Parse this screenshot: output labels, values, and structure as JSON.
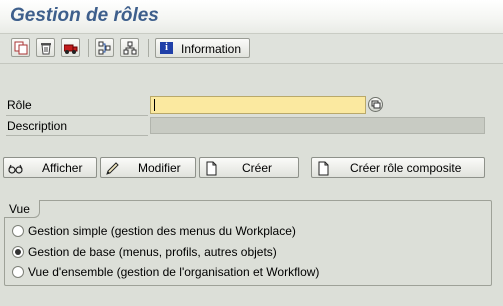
{
  "title": "Gestion de rôles",
  "toolbar": {
    "buttons": [
      {
        "name": "copy-icon"
      },
      {
        "name": "delete-icon"
      },
      {
        "name": "transport-icon"
      },
      {
        "name": "where-used-icon"
      },
      {
        "name": "hierarchy-icon"
      }
    ],
    "information_label": "Information",
    "information_icon": "info-icon"
  },
  "form": {
    "role_label": "Rôle",
    "role_value": "",
    "description_label": "Description",
    "description_value": ""
  },
  "actions": {
    "display_label": "Afficher",
    "change_label": "Modifier",
    "create_label": "Créer",
    "create_composite_label": "Créer rôle composite"
  },
  "view_group": {
    "title": "Vue",
    "options": [
      {
        "label": "Gestion simple (gestion des menus du Workplace)",
        "selected": false
      },
      {
        "label": "Gestion de base (menus, profils, autres objets)",
        "selected": true
      },
      {
        "label": "Vue d'ensemble (gestion de l'organisation et Workflow)",
        "selected": false
      }
    ]
  },
  "colors": {
    "title_text": "#3e5f8c",
    "required_field": "#fbe9a0",
    "background": "#dcdfd8"
  }
}
